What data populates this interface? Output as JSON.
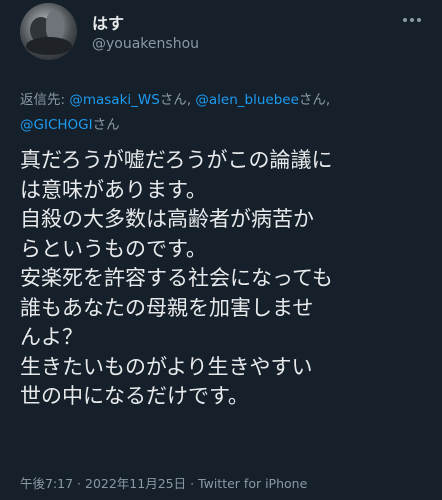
{
  "user": {
    "display_name": "はす",
    "handle": "@youakenshou"
  },
  "reply": {
    "prefix": "返信先: ",
    "mentions": [
      "@masaki_WS",
      "@alen_bluebee",
      "@GICHOGI"
    ],
    "suffix": "さん",
    "separator": ", "
  },
  "tweet": {
    "lines": [
      "真だろうが嘘だろうがこの論議に",
      "は意味があります。",
      "自殺の大多数は高齢者が病苦か",
      "らというものです。",
      "安楽死を許容する社会になっても",
      "誰もあなたの母親を加害しませ",
      "んよ？",
      "生きたいものがより生きやすい",
      "世の中になるだけです。"
    ]
  },
  "meta": {
    "time": "午後7:17",
    "date": "2022年11月25日",
    "separator": " · ",
    "source": "Twitter for iPhone"
  },
  "colors": {
    "background": "#15202b",
    "text": "#e7e9ea",
    "secondary": "#8b98a5",
    "link": "#1d9bf0"
  },
  "icons": {
    "more": "more-horizontal-icon"
  }
}
